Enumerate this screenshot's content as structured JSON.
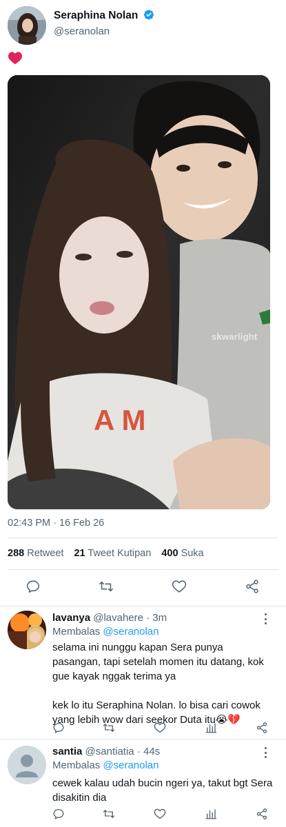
{
  "tweet": {
    "author_name": "Seraphina Nolan",
    "author_handle": "@seranolan",
    "text": "❤️",
    "image_watermark": "skwarlight",
    "timestamp": "02:43 PM · 16 Feb 26",
    "stats": {
      "retweets_count": "288",
      "retweets_label": "Retweet",
      "quotes_count": "21",
      "quotes_label": "Tweet Kutipan",
      "likes_count": "400",
      "likes_label": "Suka"
    }
  },
  "replies": [
    {
      "name": "lavanya",
      "handle": "@lavahere",
      "time": "3m",
      "replying_prefix": "Membalas",
      "replying_to": "@seranolan",
      "paragraphs": [
        "selama ini nunggu kapan Sera punya pasangan, tapi setelah momen itu datang, kok gue kayak nggak terima ya",
        "kek lo itu Seraphina Nolan. lo bisa cari cowok yang lebih wow dari seekor Duta itu😭💔"
      ]
    },
    {
      "name": "santia",
      "handle": "@santiatia",
      "time": "44s",
      "replying_prefix": "Membalas",
      "replying_to": "@seranolan",
      "paragraphs": [
        "cewek kalau udah bucin ngeri ya, takut bgt Sera disakitin dia"
      ]
    }
  ],
  "colors": {
    "accent": "#1d9bf0",
    "secondary_text": "#536471",
    "divider": "#e1e4e8",
    "heart": "#e0245e"
  }
}
